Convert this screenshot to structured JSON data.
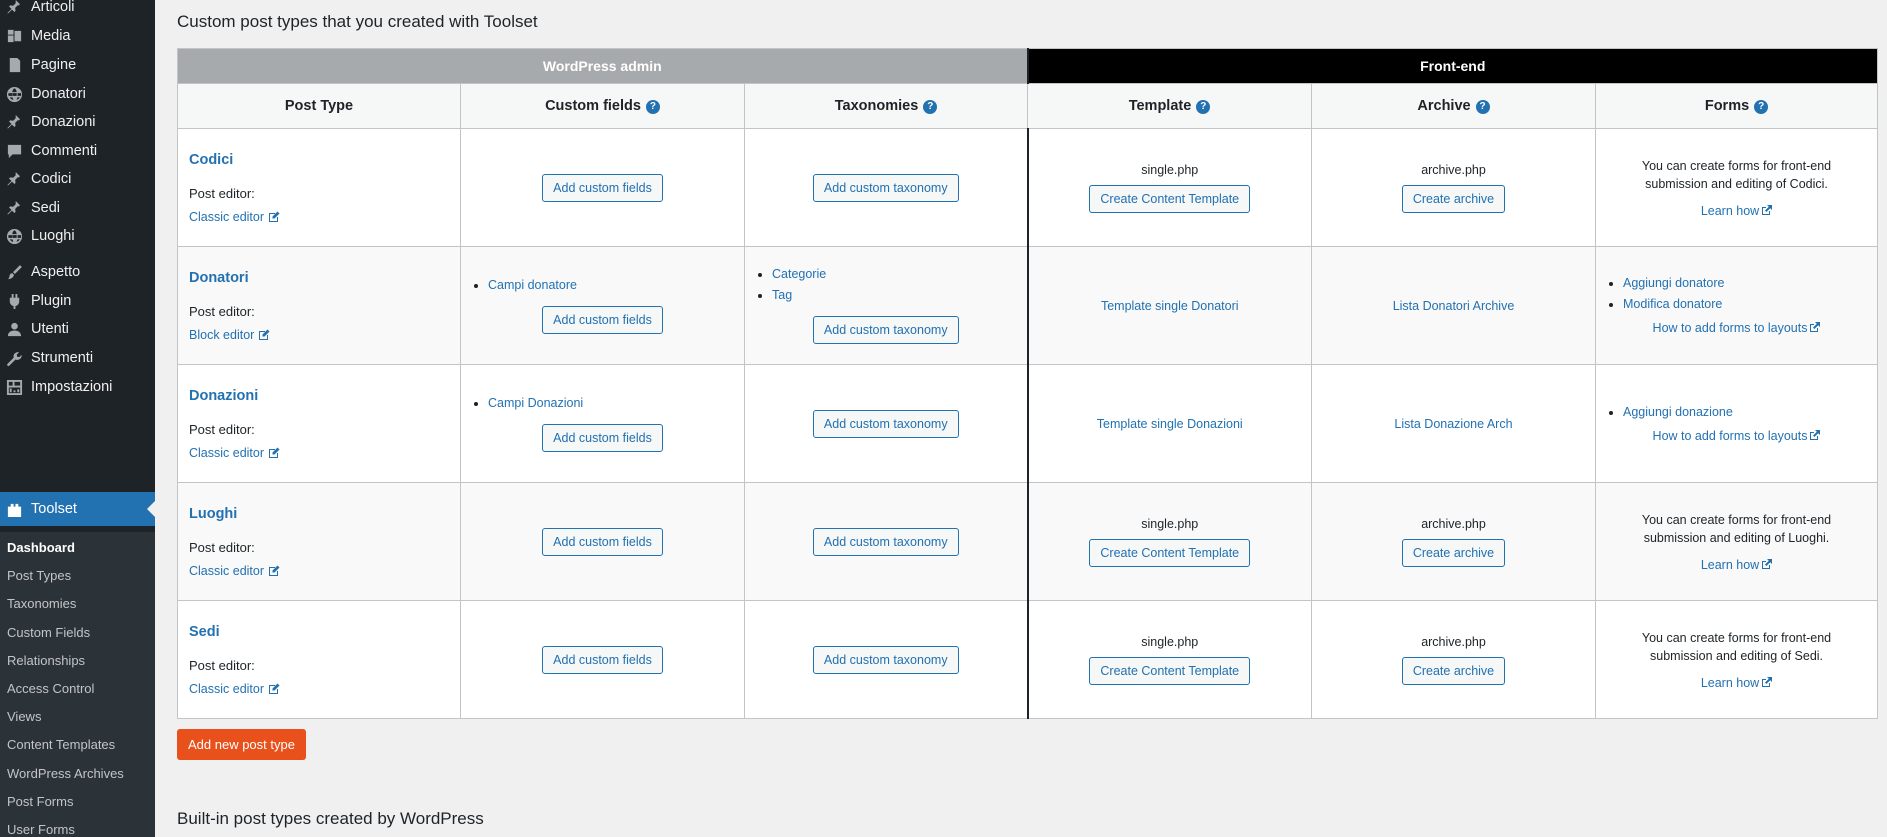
{
  "sidebar": {
    "items": [
      {
        "label": "Articoli",
        "icon": "pin-icon"
      },
      {
        "label": "Media",
        "icon": "media-icon"
      },
      {
        "label": "Pagine",
        "icon": "page-icon"
      },
      {
        "label": "Donatori",
        "icon": "globe-icon"
      },
      {
        "label": "Donazioni",
        "icon": "pin-icon"
      },
      {
        "label": "Commenti",
        "icon": "comment-icon"
      },
      {
        "label": "Codici",
        "icon": "pin-icon"
      },
      {
        "label": "Sedi",
        "icon": "pin-icon"
      },
      {
        "label": "Luoghi",
        "icon": "globe-icon"
      },
      {
        "label": "Aspetto",
        "icon": "brush-icon"
      },
      {
        "label": "Plugin",
        "icon": "plugin-icon"
      },
      {
        "label": "Utenti",
        "icon": "user-icon"
      },
      {
        "label": "Strumenti",
        "icon": "wrench-icon"
      },
      {
        "label": "Impostazioni",
        "icon": "settings-icon"
      }
    ],
    "active": {
      "label": "Toolset",
      "icon": "toolset-icon"
    },
    "submenu": [
      "Dashboard",
      "Post Types",
      "Taxonomies",
      "Custom Fields",
      "Relationships",
      "Access Control",
      "Views",
      "Content Templates",
      "WordPress Archives",
      "Post Forms",
      "User Forms"
    ]
  },
  "main": {
    "title": "Custom post types that you created with Toolset",
    "group_admin": "WordPress admin",
    "group_front": "Front-end",
    "columns": {
      "post_type": "Post Type",
      "custom_fields": "Custom fields",
      "taxonomies": "Taxonomies",
      "template": "Template",
      "archive": "Archive",
      "forms": "Forms"
    },
    "help_glyph": "?",
    "post_editor_label": "Post editor:",
    "add_fields_label": "Add custom fields",
    "add_taxonomy_label": "Add custom taxonomy",
    "create_template_label": "Create Content Template",
    "create_archive_label": "Create archive",
    "learn_how": "Learn how",
    "how_to_layouts": "How to add forms to layouts",
    "rows": [
      {
        "name": "Codici",
        "editor": "Classic editor",
        "field_groups": [],
        "taxonomies": [],
        "template_file": "single.php",
        "template_link": "",
        "archive_file": "archive.php",
        "archive_link": "",
        "forms_note": "You can create forms for front-end submission and editing of Codici.",
        "forms": []
      },
      {
        "name": "Donatori",
        "editor": "Block editor",
        "field_groups": [
          "Campi donatore"
        ],
        "taxonomies": [
          "Categorie",
          "Tag"
        ],
        "template_file": "",
        "template_link": "Template single Donatori",
        "archive_file": "",
        "archive_link": "Lista Donatori Archive",
        "forms_note": "",
        "forms": [
          "Aggiungi donatore",
          "Modifica donatore"
        ]
      },
      {
        "name": "Donazioni",
        "editor": "Classic editor",
        "field_groups": [
          "Campi Donazioni"
        ],
        "taxonomies": [],
        "template_file": "",
        "template_link": "Template single Donazioni",
        "archive_file": "",
        "archive_link": "Lista Donazione Arch",
        "forms_note": "",
        "forms": [
          "Aggiungi donazione"
        ]
      },
      {
        "name": "Luoghi",
        "editor": "Classic editor",
        "field_groups": [],
        "taxonomies": [],
        "template_file": "single.php",
        "template_link": "",
        "archive_file": "archive.php",
        "archive_link": "",
        "forms_note": "You can create forms for front-end submission and editing of Luoghi.",
        "forms": []
      },
      {
        "name": "Sedi",
        "editor": "Classic editor",
        "field_groups": [],
        "taxonomies": [],
        "template_file": "single.php",
        "template_link": "",
        "archive_file": "archive.php",
        "archive_link": "",
        "forms_note": "You can create forms for front-end submission and editing of Sedi.",
        "forms": []
      }
    ],
    "add_new_label": "Add new post type",
    "builtin_title": "Built-in post types created by WordPress"
  },
  "colors": {
    "sidebar_bg": "#1d2327",
    "active_bg": "#2271b1",
    "link": "#2271b1",
    "add_new_bg": "#e8501c",
    "admin_header": "#a7aaad",
    "front_header": "#000000"
  }
}
